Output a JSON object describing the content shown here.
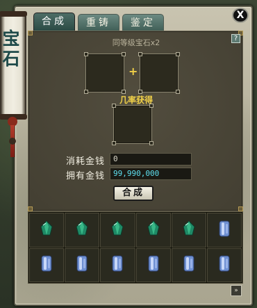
{
  "window": {
    "title": "宝石"
  },
  "tabs": [
    {
      "label": "合成",
      "active": true
    },
    {
      "label": "重铸",
      "active": false
    },
    {
      "label": "鉴定",
      "active": false
    }
  ],
  "close_label": "X",
  "help_label": "?",
  "compose": {
    "requirement": "同等级宝石x2",
    "plus": "+",
    "probability_label": "几率获得",
    "cost_label": "消耗金钱",
    "cost_value": "0",
    "owned_label": "拥有金钱",
    "owned_value": "99,990,000",
    "button_label": "合成"
  },
  "inventory": {
    "rows": [
      [
        "green-gem-icon",
        "green-gem-icon",
        "green-gem-icon",
        "green-gem-icon",
        "green-gem-icon",
        "blue-crystal-icon"
      ],
      [
        "blue-crystal-icon",
        "blue-crystal-icon",
        "blue-crystal-icon",
        "blue-crystal-icon",
        "blue-crystal-icon",
        "blue-crystal-icon"
      ]
    ],
    "next_label": "»"
  },
  "colors": {
    "accent_text": "#f0d048",
    "money_text": "#5fe0f0",
    "tab_fill": "#3d5c54"
  }
}
